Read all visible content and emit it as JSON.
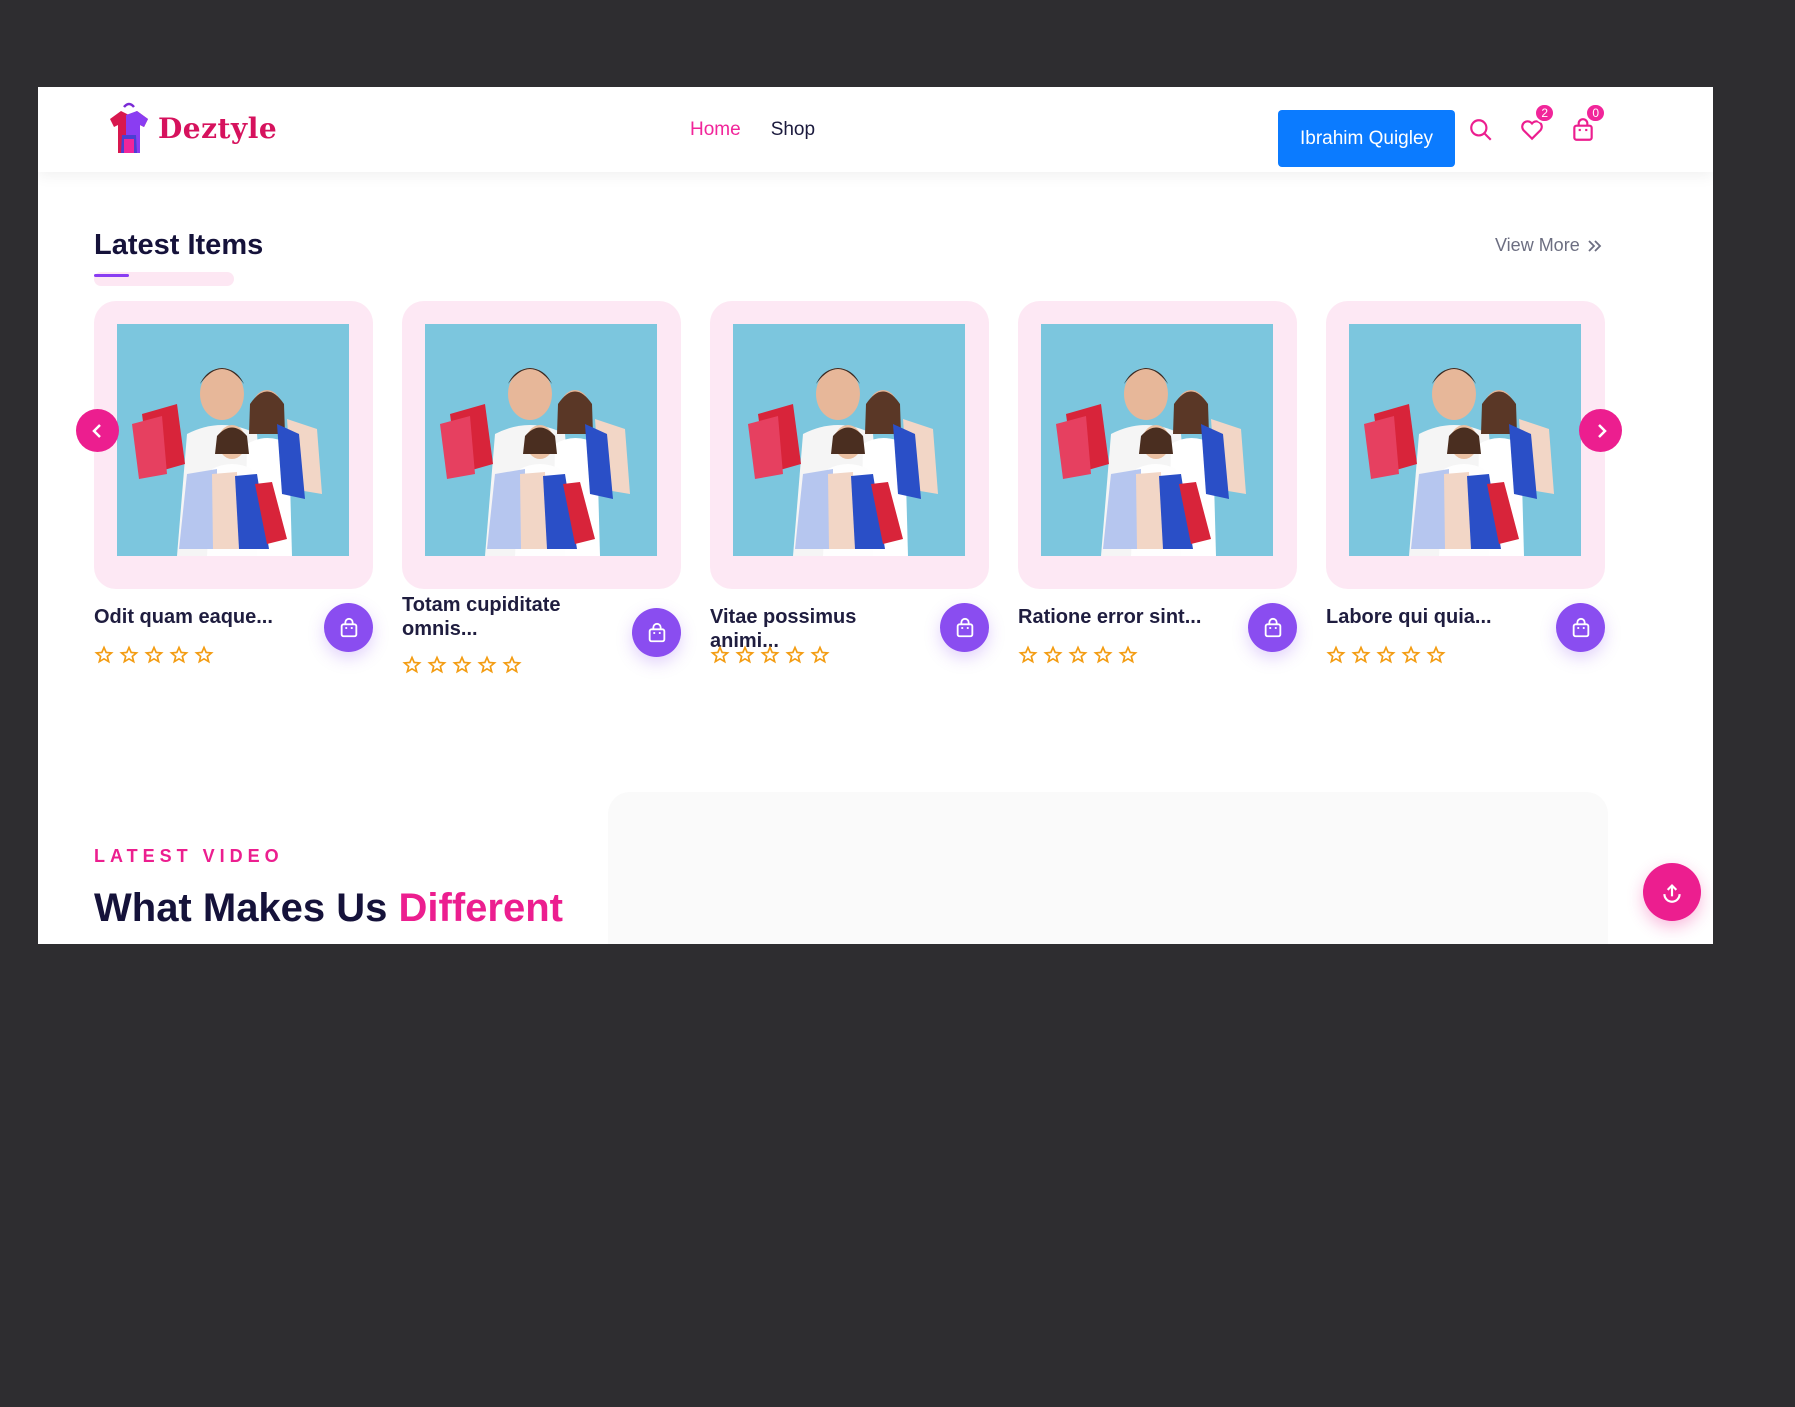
{
  "header": {
    "brand": "Deztyle",
    "nav": [
      {
        "label": "Home",
        "active": true
      },
      {
        "label": "Shop",
        "active": false
      }
    ],
    "user_button": "Ibrahim Quigley",
    "icons": {
      "search": "search-icon",
      "wishlist": "heart-icon",
      "cart": "shopping-bag-icon"
    },
    "wishlist_count": "2",
    "cart_count": "0"
  },
  "latest_items": {
    "title": "Latest Items",
    "view_more": "View More",
    "items": [
      {
        "name": "Odit quam eaque...",
        "rating": 0
      },
      {
        "name": "Totam cupiditate omnis...",
        "rating": 0
      },
      {
        "name": "Vitae possimus animi...",
        "rating": 0
      },
      {
        "name": "Ratione error sint...",
        "rating": 0
      },
      {
        "name": "Labore qui quia...",
        "rating": 0
      }
    ]
  },
  "latest_video": {
    "tag": "LATEST VIDEO",
    "heading_part1": "What Makes Us ",
    "heading_highlight": "Different"
  },
  "colors": {
    "brand_pink": "#ec1e8f",
    "accent_purple": "#8a4df0",
    "button_blue": "#0b7bff",
    "star_orange": "#f39c12"
  }
}
